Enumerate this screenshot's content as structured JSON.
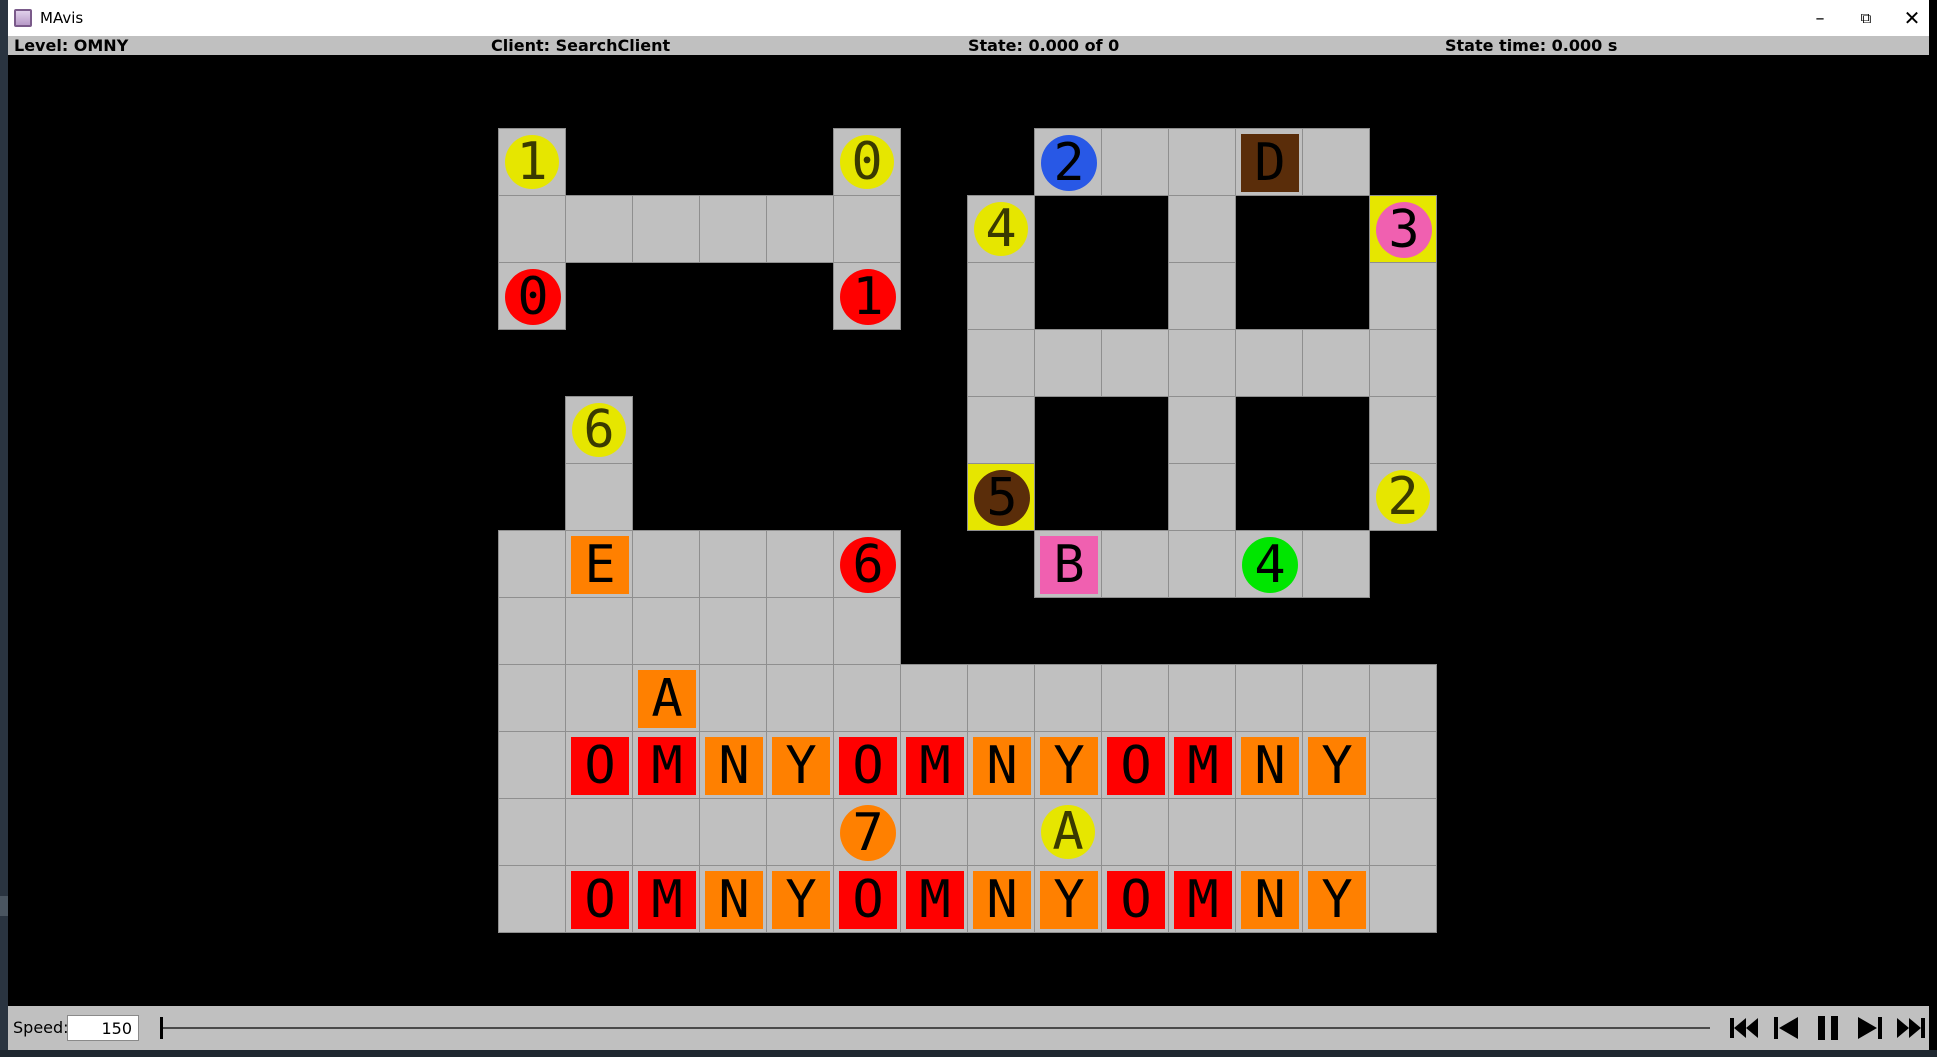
{
  "window": {
    "title": "MAvis"
  },
  "status": {
    "level": "Level: OMNY",
    "client": "Client: SearchClient",
    "state": "State: 0.000 of 0",
    "state_time": "State time: 0.000 s"
  },
  "controls": {
    "speed_label": "Speed:",
    "speed_value": "150"
  },
  "colors": {
    "floor": "#c0c0c0",
    "wall": "#000000",
    "goal_cell": "#e6e600",
    "red": "#ff0000",
    "orange": "#ff8000",
    "yellow": "#e6e600",
    "blue": "#2858e6",
    "pink": "#f060b0",
    "brown": "#5a2d0a",
    "green": "#00e600"
  },
  "board": {
    "cols": 14,
    "rows": 12,
    "floor": [
      [
        0,
        0
      ],
      [
        5,
        0
      ],
      [
        8,
        0
      ],
      [
        9,
        0
      ],
      [
        10,
        0
      ],
      [
        11,
        0
      ],
      [
        12,
        0
      ],
      [
        0,
        1
      ],
      [
        1,
        1
      ],
      [
        2,
        1
      ],
      [
        3,
        1
      ],
      [
        4,
        1
      ],
      [
        5,
        1
      ],
      [
        7,
        1
      ],
      [
        10,
        1
      ],
      [
        13,
        1
      ],
      [
        0,
        2
      ],
      [
        5,
        2
      ],
      [
        7,
        2
      ],
      [
        10,
        2
      ],
      [
        13,
        2
      ],
      [
        7,
        3
      ],
      [
        8,
        3
      ],
      [
        9,
        3
      ],
      [
        10,
        3
      ],
      [
        11,
        3
      ],
      [
        12,
        3
      ],
      [
        13,
        3
      ],
      [
        1,
        4
      ],
      [
        7,
        4
      ],
      [
        10,
        4
      ],
      [
        13,
        4
      ],
      [
        1,
        5
      ],
      [
        7,
        5
      ],
      [
        10,
        5
      ],
      [
        13,
        5
      ],
      [
        0,
        6
      ],
      [
        1,
        6
      ],
      [
        2,
        6
      ],
      [
        3,
        6
      ],
      [
        4,
        6
      ],
      [
        5,
        6
      ],
      [
        8,
        6
      ],
      [
        9,
        6
      ],
      [
        10,
        6
      ],
      [
        11,
        6
      ],
      [
        12,
        6
      ],
      [
        0,
        7
      ],
      [
        1,
        7
      ],
      [
        2,
        7
      ],
      [
        3,
        7
      ],
      [
        4,
        7
      ],
      [
        5,
        7
      ],
      [
        0,
        8
      ],
      [
        1,
        8
      ],
      [
        2,
        8
      ],
      [
        3,
        8
      ],
      [
        4,
        8
      ],
      [
        5,
        8
      ],
      [
        6,
        8
      ],
      [
        7,
        8
      ],
      [
        8,
        8
      ],
      [
        9,
        8
      ],
      [
        10,
        8
      ],
      [
        11,
        8
      ],
      [
        12,
        8
      ],
      [
        13,
        8
      ],
      [
        0,
        9
      ],
      [
        1,
        9
      ],
      [
        2,
        9
      ],
      [
        3,
        9
      ],
      [
        4,
        9
      ],
      [
        5,
        9
      ],
      [
        6,
        9
      ],
      [
        7,
        9
      ],
      [
        8,
        9
      ],
      [
        9,
        9
      ],
      [
        10,
        9
      ],
      [
        11,
        9
      ],
      [
        12,
        9
      ],
      [
        13,
        9
      ],
      [
        0,
        10
      ],
      [
        1,
        10
      ],
      [
        2,
        10
      ],
      [
        3,
        10
      ],
      [
        4,
        10
      ],
      [
        5,
        10
      ],
      [
        6,
        10
      ],
      [
        7,
        10
      ],
      [
        8,
        10
      ],
      [
        9,
        10
      ],
      [
        10,
        10
      ],
      [
        11,
        10
      ],
      [
        12,
        10
      ],
      [
        13,
        10
      ],
      [
        0,
        11
      ],
      [
        1,
        11
      ],
      [
        2,
        11
      ],
      [
        3,
        11
      ],
      [
        4,
        11
      ],
      [
        5,
        11
      ],
      [
        6,
        11
      ],
      [
        7,
        11
      ],
      [
        8,
        11
      ],
      [
        9,
        11
      ],
      [
        10,
        11
      ],
      [
        11,
        11
      ],
      [
        12,
        11
      ],
      [
        13,
        11
      ]
    ],
    "goals": [
      {
        "col": 0,
        "row": 0,
        "label": "1"
      },
      {
        "col": 5,
        "row": 0,
        "label": "0"
      },
      {
        "col": 7,
        "row": 1,
        "label": "4"
      },
      {
        "col": 13,
        "row": 1,
        "label": ""
      },
      {
        "col": 1,
        "row": 4,
        "label": "6"
      },
      {
        "col": 7,
        "row": 5,
        "label": ""
      },
      {
        "col": 13,
        "row": 5,
        "label": "2"
      },
      {
        "col": 8,
        "row": 10,
        "label": "A"
      }
    ],
    "agents": [
      {
        "col": 8,
        "row": 0,
        "label": "2",
        "color": "blue"
      },
      {
        "col": 13,
        "row": 1,
        "label": "3",
        "color": "pink"
      },
      {
        "col": 0,
        "row": 2,
        "label": "0",
        "color": "red"
      },
      {
        "col": 5,
        "row": 2,
        "label": "1",
        "color": "red"
      },
      {
        "col": 7,
        "row": 5,
        "label": "5",
        "color": "brown"
      },
      {
        "col": 5,
        "row": 6,
        "label": "6",
        "color": "red"
      },
      {
        "col": 11,
        "row": 6,
        "label": "4",
        "color": "green"
      },
      {
        "col": 5,
        "row": 10,
        "label": "7",
        "color": "orange"
      }
    ],
    "boxes": [
      {
        "col": 11,
        "row": 0,
        "label": "D",
        "color": "brown"
      },
      {
        "col": 1,
        "row": 6,
        "label": "E",
        "color": "orange"
      },
      {
        "col": 8,
        "row": 6,
        "label": "B",
        "color": "pink"
      },
      {
        "col": 2,
        "row": 8,
        "label": "A",
        "color": "orange"
      },
      {
        "col": 1,
        "row": 9,
        "label": "O",
        "color": "red"
      },
      {
        "col": 2,
        "row": 9,
        "label": "M",
        "color": "red"
      },
      {
        "col": 3,
        "row": 9,
        "label": "N",
        "color": "orange"
      },
      {
        "col": 4,
        "row": 9,
        "label": "Y",
        "color": "orange"
      },
      {
        "col": 5,
        "row": 9,
        "label": "O",
        "color": "red"
      },
      {
        "col": 6,
        "row": 9,
        "label": "M",
        "color": "red"
      },
      {
        "col": 7,
        "row": 9,
        "label": "N",
        "color": "orange"
      },
      {
        "col": 8,
        "row": 9,
        "label": "Y",
        "color": "orange"
      },
      {
        "col": 9,
        "row": 9,
        "label": "O",
        "color": "red"
      },
      {
        "col": 10,
        "row": 9,
        "label": "M",
        "color": "red"
      },
      {
        "col": 11,
        "row": 9,
        "label": "N",
        "color": "orange"
      },
      {
        "col": 12,
        "row": 9,
        "label": "Y",
        "color": "orange"
      },
      {
        "col": 1,
        "row": 11,
        "label": "O",
        "color": "red"
      },
      {
        "col": 2,
        "row": 11,
        "label": "M",
        "color": "red"
      },
      {
        "col": 3,
        "row": 11,
        "label": "N",
        "color": "orange"
      },
      {
        "col": 4,
        "row": 11,
        "label": "Y",
        "color": "orange"
      },
      {
        "col": 5,
        "row": 11,
        "label": "O",
        "color": "red"
      },
      {
        "col": 6,
        "row": 11,
        "label": "M",
        "color": "red"
      },
      {
        "col": 7,
        "row": 11,
        "label": "N",
        "color": "orange"
      },
      {
        "col": 8,
        "row": 11,
        "label": "Y",
        "color": "orange"
      },
      {
        "col": 9,
        "row": 11,
        "label": "O",
        "color": "red"
      },
      {
        "col": 10,
        "row": 11,
        "label": "M",
        "color": "red"
      },
      {
        "col": 11,
        "row": 11,
        "label": "N",
        "color": "orange"
      },
      {
        "col": 12,
        "row": 11,
        "label": "Y",
        "color": "orange"
      }
    ]
  }
}
